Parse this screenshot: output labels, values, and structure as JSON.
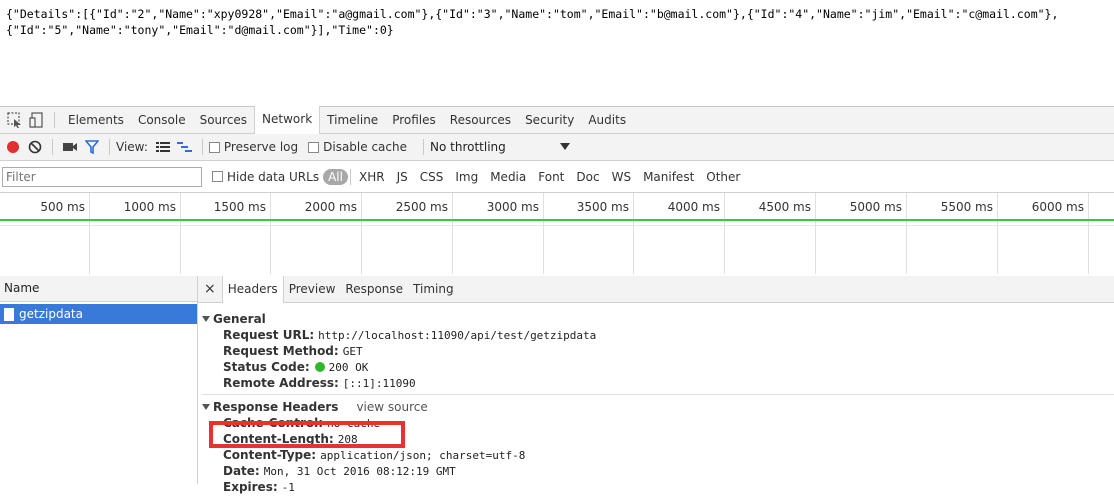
{
  "page": {
    "json_text": "{\"Details\":[{\"Id\":\"2\",\"Name\":\"xpy0928\",\"Email\":\"a@gmail.com\"},{\"Id\":\"3\",\"Name\":\"tom\",\"Email\":\"b@mail.com\"},{\"Id\":\"4\",\"Name\":\"jim\",\"Email\":\"c@mail.com\"},\n{\"Id\":\"5\",\"Name\":\"tony\",\"Email\":\"d@mail.com\"}],\"Time\":0}"
  },
  "devtools": {
    "tabs": [
      "Elements",
      "Console",
      "Sources",
      "Network",
      "Timeline",
      "Profiles",
      "Resources",
      "Security",
      "Audits"
    ],
    "active_tab": "Network",
    "toolbar": {
      "view_label": "View:",
      "preserve_log": "Preserve log",
      "disable_cache": "Disable cache",
      "throttling": "No throttling"
    },
    "filter": {
      "placeholder": "Filter",
      "hide_data_urls": "Hide data URLs",
      "types": [
        "All",
        "XHR",
        "JS",
        "CSS",
        "Img",
        "Media",
        "Font",
        "Doc",
        "WS",
        "Manifest",
        "Other"
      ]
    },
    "timeline": {
      "ticks": [
        "500 ms",
        "1000 ms",
        "1500 ms",
        "2000 ms",
        "2500 ms",
        "3000 ms",
        "3500 ms",
        "4000 ms",
        "4500 ms",
        "5000 ms",
        "5500 ms",
        "6000 ms"
      ]
    },
    "request_list": {
      "header": "Name",
      "items": [
        "getzipdata"
      ]
    },
    "details": {
      "close_glyph": "×",
      "tabs": [
        "Headers",
        "Preview",
        "Response",
        "Timing"
      ],
      "general": {
        "title": "General",
        "request_url_key": "Request URL:",
        "request_url": "http://localhost:11090/api/test/getzipdata",
        "request_method_key": "Request Method:",
        "request_method": "GET",
        "status_code_key": "Status Code:",
        "status_code": "200 OK",
        "remote_address_key": "Remote Address:",
        "remote_address": "[::1]:11090"
      },
      "response_headers": {
        "title": "Response Headers",
        "view_source": "view source",
        "cache_control_key": "Cache-Control:",
        "cache_control": "no-cache",
        "content_length_key": "Content-Length:",
        "content_length": "208",
        "content_type_key": "Content-Type:",
        "content_type": "application/json; charset=utf-8",
        "date_key": "Date:",
        "date": "Mon, 31 Oct 2016 08:12:19 GMT",
        "expires_key": "Expires:",
        "expires": "-1"
      }
    }
  },
  "colors": {
    "highlight": "#e8322f",
    "selected_row": "#3879d9",
    "timeline_green": "#33cc33",
    "record_red": "#e03030"
  }
}
